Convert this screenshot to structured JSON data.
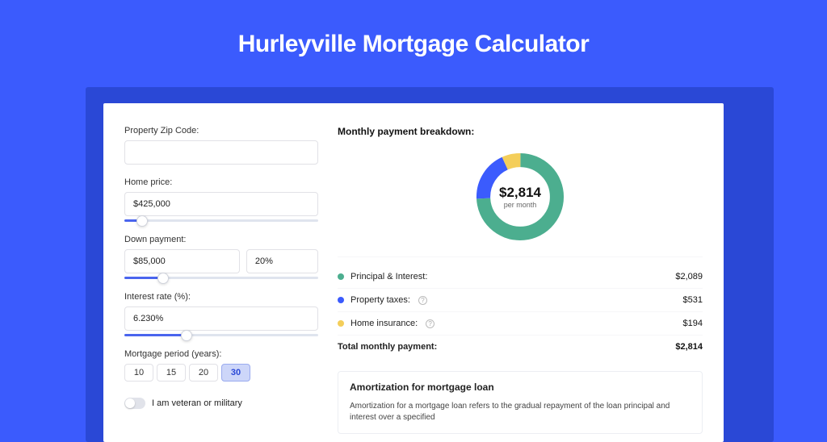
{
  "title": "Hurleyville Mortgage Calculator",
  "colors": {
    "green": "#4cae8f",
    "blue": "#3b5bfd",
    "yellow": "#f4ce5a"
  },
  "form": {
    "zip": {
      "label": "Property Zip Code:",
      "value": ""
    },
    "home_price": {
      "label": "Home price:",
      "value": "$425,000",
      "slider_pct": 9
    },
    "down_payment": {
      "label": "Down payment:",
      "value": "$85,000",
      "pct_value": "20%",
      "slider_pct": 20
    },
    "interest": {
      "label": "Interest rate (%):",
      "value": "6.230%",
      "slider_pct": 32
    },
    "period": {
      "label": "Mortgage period (years):",
      "options": [
        "10",
        "15",
        "20",
        "30"
      ],
      "active": "30"
    },
    "veteran": {
      "label": "I am veteran or military"
    }
  },
  "breakdown": {
    "title": "Monthly payment breakdown:",
    "total_value": "$2,814",
    "per_label": "per month",
    "items": [
      {
        "label": "Principal & Interest:",
        "value": "$2,089",
        "color": "#4cae8f",
        "info": false
      },
      {
        "label": "Property taxes:",
        "value": "$531",
        "color": "#3b5bfd",
        "info": true
      },
      {
        "label": "Home insurance:",
        "value": "$194",
        "color": "#f4ce5a",
        "info": true
      }
    ],
    "total_label": "Total monthly payment:"
  },
  "amort": {
    "title": "Amortization for mortgage loan",
    "text": "Amortization for a mortgage loan refers to the gradual repayment of the loan principal and interest over a specified"
  },
  "chart_data": {
    "type": "pie",
    "title": "Monthly payment breakdown",
    "series": [
      {
        "name": "Principal & Interest",
        "value": 2089,
        "color": "#4cae8f"
      },
      {
        "name": "Property taxes",
        "value": 531,
        "color": "#3b5bfd"
      },
      {
        "name": "Home insurance",
        "value": 194,
        "color": "#f4ce5a"
      }
    ],
    "center_label": "$2,814",
    "center_sublabel": "per month"
  }
}
